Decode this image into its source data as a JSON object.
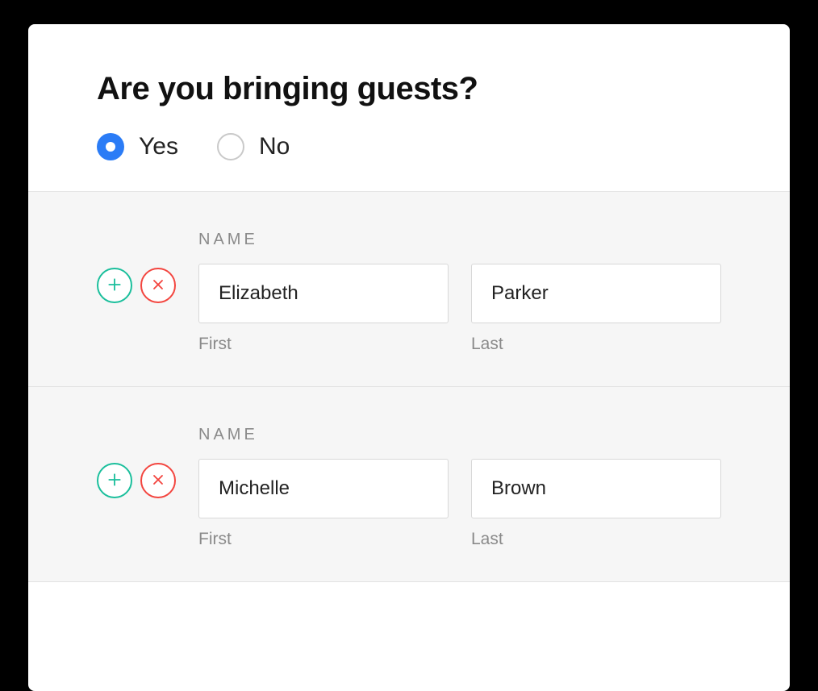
{
  "question": "Are you bringing guests?",
  "options": {
    "yes": "Yes",
    "no": "No",
    "selected": "yes"
  },
  "section_label": "NAME",
  "field_labels": {
    "first": "First",
    "last": "Last"
  },
  "guests": [
    {
      "first": "Elizabeth",
      "last": "Parker"
    },
    {
      "first": "Michelle",
      "last": "Brown"
    }
  ]
}
